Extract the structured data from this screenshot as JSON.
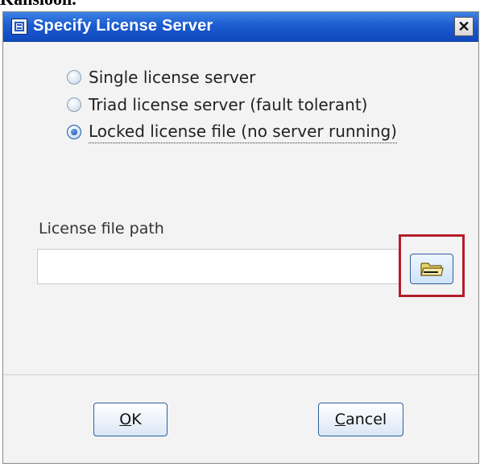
{
  "window": {
    "title": "Specify License Server",
    "close_label": "✕",
    "top_crop_text": "Kansiooli."
  },
  "server_type": {
    "options": [
      {
        "label": "Single license server",
        "checked": false
      },
      {
        "label": "Triad license server (fault tolerant)",
        "checked": false
      },
      {
        "label": "Locked license file (no server running)",
        "checked": true
      }
    ]
  },
  "license_file": {
    "label": "License file path",
    "value": "",
    "placeholder": "",
    "browse_icon": "folder-icon"
  },
  "buttons": {
    "ok_mnemonic": "O",
    "ok_rest": "K",
    "cancel_mnemonic": "C",
    "cancel_rest": "ancel"
  },
  "colors": {
    "titlebar": "#1c5bd0",
    "highlight": "#b51c2a",
    "button_border": "#2f5f9f"
  }
}
